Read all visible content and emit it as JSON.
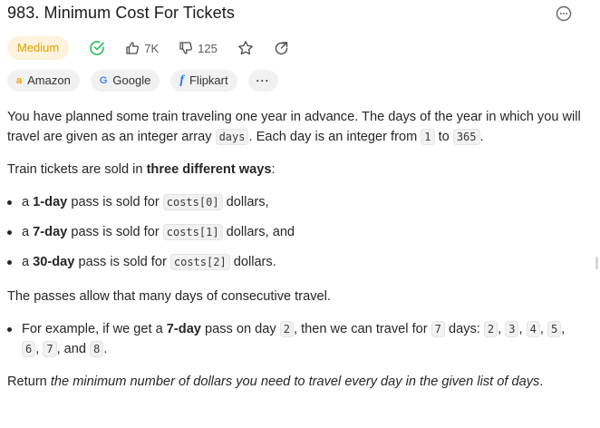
{
  "problem": {
    "title": "983. Minimum Cost For Tickets",
    "difficulty": "Medium",
    "likes": "7K",
    "dislikes": "125"
  },
  "tags": [
    {
      "logo": "a",
      "label": "Amazon"
    },
    {
      "logo": "G",
      "label": "Google"
    },
    {
      "logo": "f",
      "label": "Flipkart"
    }
  ],
  "tags_more": "···",
  "description": {
    "p1_a": "You have planned some train traveling one year in advance. The days of the year in which you will travel are given as an integer array ",
    "p1_code1": "days",
    "p1_b": ". Each day is an integer from ",
    "p1_code2": "1",
    "p1_c": " to ",
    "p1_code3": "365",
    "p1_d": ".",
    "p2_a": "Train tickets are sold in ",
    "p2_bold": "three different ways",
    "p2_b": ":",
    "passes": [
      {
        "pre": "a ",
        "bold": "1-day",
        "mid": " pass is sold for ",
        "code": "costs[0]",
        "post": " dollars,"
      },
      {
        "pre": "a ",
        "bold": "7-day",
        "mid": " pass is sold for ",
        "code": "costs[1]",
        "post": " dollars, and"
      },
      {
        "pre": "a ",
        "bold": "30-day",
        "mid": " pass is sold for ",
        "code": "costs[2]",
        "post": " dollars."
      }
    ],
    "p3": "The passes allow that many days of consecutive travel.",
    "example": {
      "a": "For example, if we get a ",
      "bold": "7-day",
      "b": " pass on day ",
      "c2": "2",
      "c": ", then we can travel for ",
      "c7": "7",
      "d": " days: ",
      "days": [
        "2",
        "3",
        "4",
        "5",
        "6",
        "7",
        "8"
      ],
      "sep": ", ",
      "and": ", and ",
      "end": "."
    },
    "p4_a": "Return ",
    "p4_em": "the minimum number of dollars you need to travel every day in the given list of days",
    "p4_b": "."
  },
  "colors": {
    "badge_bg": "#fdf3dc",
    "badge_text": "#e0a100",
    "solved_check": "#2cbb5d"
  },
  "icons": [
    "more-options-icon",
    "solved-check-icon",
    "thumbs-up-icon",
    "thumbs-down-icon",
    "star-icon",
    "share-icon"
  ]
}
